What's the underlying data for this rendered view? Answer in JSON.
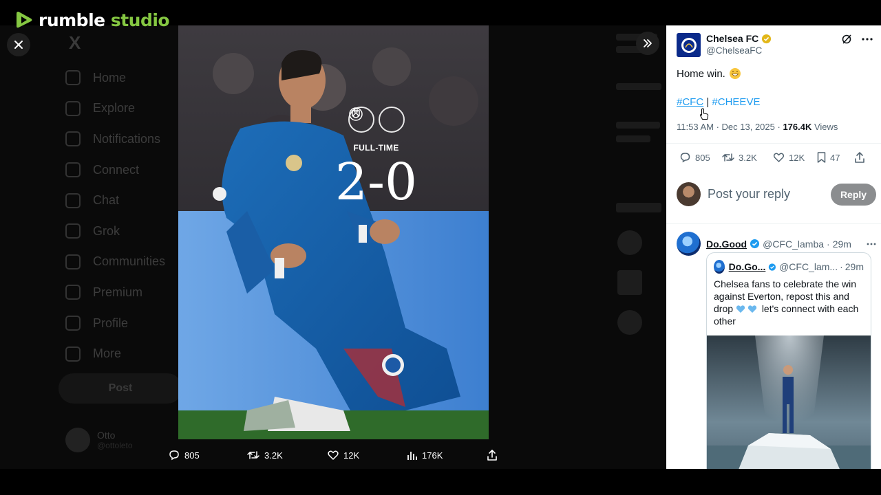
{
  "watermark": {
    "brand_part1": "rumble",
    "brand_part2": "studio"
  },
  "background_nav": {
    "items": [
      "Home",
      "Explore",
      "Notifications",
      "Connect",
      "Chat",
      "Grok",
      "Communities",
      "Premium",
      "Profile",
      "More"
    ],
    "post_label": "Post",
    "user_name": "Otto",
    "user_handle": "@ottoleto"
  },
  "media": {
    "fulltime_label": "FULL-TIME",
    "score": "2-0",
    "actions": {
      "replies": "805",
      "reposts": "3.2K",
      "likes": "12K",
      "views": "176K"
    }
  },
  "tweet": {
    "name": "Chelsea FC",
    "handle": "@ChelseaFC",
    "text": "Home win.",
    "tag1": "#CFC",
    "separator": "|",
    "tag2": "#CHEEVE",
    "time": "11:53 AM",
    "date": "Dec 13, 2025",
    "views_count": "176.4K",
    "views_label": "Views",
    "replies": "805",
    "reposts": "3.2K",
    "likes": "12K",
    "bookmarks": "47",
    "reply_placeholder": "Post your reply",
    "reply_button": "Reply"
  },
  "reply": {
    "name": "Do.Good",
    "handle": "@CFC_lamba",
    "age": "29m",
    "quote": {
      "name": "Do.Go...",
      "handle": "@CFC_lam...",
      "age": "29m",
      "text_part1": "Chelsea fans to celebrate the win against Everton, repost this and drop",
      "text_part2": "let's connect with each other"
    }
  },
  "colors": {
    "accent_link": "#1d9bf0",
    "verified_gold": "#e2b719",
    "verified_blue": "#1d9bf0",
    "rumble_green": "#85c742"
  }
}
